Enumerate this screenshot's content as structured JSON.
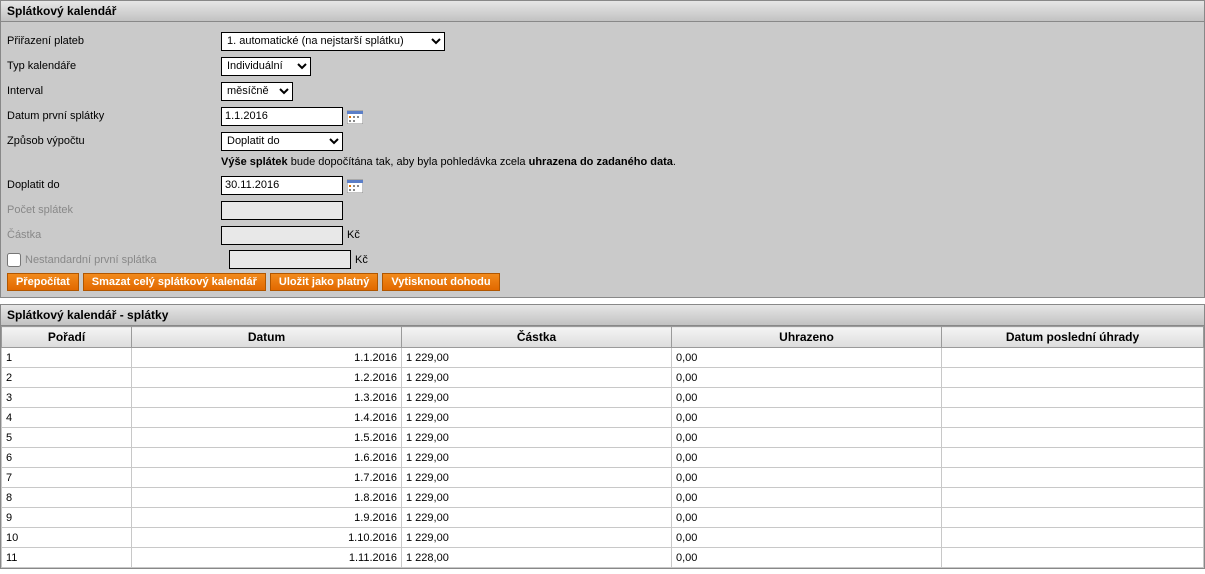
{
  "panel1": {
    "title": "Splátkový kalendář",
    "labels": {
      "prirazeni": "Přiřazení plateb",
      "typ": "Typ kalendáře",
      "interval": "Interval",
      "datum_prvni": "Datum první splátky",
      "zpusob": "Způsob výpočtu",
      "doplatit_do": "Doplatit do",
      "pocet_splatek": "Počet splátek",
      "castka": "Částka",
      "nestandardni": "Nestandardní první splátka"
    },
    "selects": {
      "prirazeni": "1. automatické (na nejstarší splátku)",
      "typ": "Individuální",
      "interval": "měsíčně",
      "zpusob": "Doplatit do"
    },
    "inputs": {
      "datum_prvni": "1.1.2016",
      "doplatit_do": "30.11.2016",
      "pocet_splatek": "",
      "castka": "",
      "nestandardni_castka": ""
    },
    "currency": "Kč",
    "description": {
      "prefix": "Výše splátek",
      "middle": " bude dopočítána tak, aby byla pohledávka zcela ",
      "bold2": "uhrazena do zadaného data",
      "suffix": "."
    },
    "buttons": {
      "prepocitat": "Přepočítat",
      "smazat": "Smazat celý splátkový kalendář",
      "ulozit": "Uložit jako platný",
      "vytisknout": "Vytisknout dohodu"
    }
  },
  "panel2": {
    "title": "Splátkový kalendář - splátky",
    "columns": {
      "poradi": "Pořadí",
      "datum": "Datum",
      "castka": "Částka",
      "uhrazeno": "Uhrazeno",
      "dpu": "Datum poslední úhrady"
    },
    "rows": [
      {
        "poradi": "1",
        "datum": "1.1.2016",
        "castka": "1 229,00",
        "uhrazeno": "0,00",
        "dpu": ""
      },
      {
        "poradi": "2",
        "datum": "1.2.2016",
        "castka": "1 229,00",
        "uhrazeno": "0,00",
        "dpu": ""
      },
      {
        "poradi": "3",
        "datum": "1.3.2016",
        "castka": "1 229,00",
        "uhrazeno": "0,00",
        "dpu": ""
      },
      {
        "poradi": "4",
        "datum": "1.4.2016",
        "castka": "1 229,00",
        "uhrazeno": "0,00",
        "dpu": ""
      },
      {
        "poradi": "5",
        "datum": "1.5.2016",
        "castka": "1 229,00",
        "uhrazeno": "0,00",
        "dpu": ""
      },
      {
        "poradi": "6",
        "datum": "1.6.2016",
        "castka": "1 229,00",
        "uhrazeno": "0,00",
        "dpu": ""
      },
      {
        "poradi": "7",
        "datum": "1.7.2016",
        "castka": "1 229,00",
        "uhrazeno": "0,00",
        "dpu": ""
      },
      {
        "poradi": "8",
        "datum": "1.8.2016",
        "castka": "1 229,00",
        "uhrazeno": "0,00",
        "dpu": ""
      },
      {
        "poradi": "9",
        "datum": "1.9.2016",
        "castka": "1 229,00",
        "uhrazeno": "0,00",
        "dpu": ""
      },
      {
        "poradi": "10",
        "datum": "1.10.2016",
        "castka": "1 229,00",
        "uhrazeno": "0,00",
        "dpu": ""
      },
      {
        "poradi": "11",
        "datum": "1.11.2016",
        "castka": "1 228,00",
        "uhrazeno": "0,00",
        "dpu": ""
      }
    ]
  }
}
